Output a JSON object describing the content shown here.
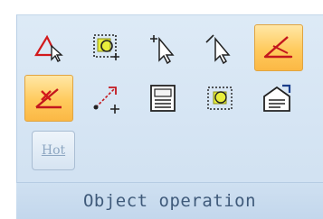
{
  "ribbon_group": {
    "label": "Object operation",
    "row1": [
      {
        "icon": "triangle-pointer-icon",
        "active": false
      },
      {
        "icon": "select-frame-icon",
        "active": false
      },
      {
        "icon": "add-point-pointer-icon",
        "active": false
      },
      {
        "icon": "edit-pointer-icon",
        "active": false
      },
      {
        "icon": "line-segment-icon",
        "active": true
      }
    ],
    "row2": [
      {
        "icon": "delete-line-icon",
        "active": true
      },
      {
        "icon": "add-node-icon",
        "active": false
      },
      {
        "icon": "text-block-icon",
        "active": false
      },
      {
        "icon": "group-select-icon",
        "active": false
      },
      {
        "icon": "properties-icon",
        "active": false
      }
    ],
    "hot_button": {
      "label": "Hot"
    }
  }
}
